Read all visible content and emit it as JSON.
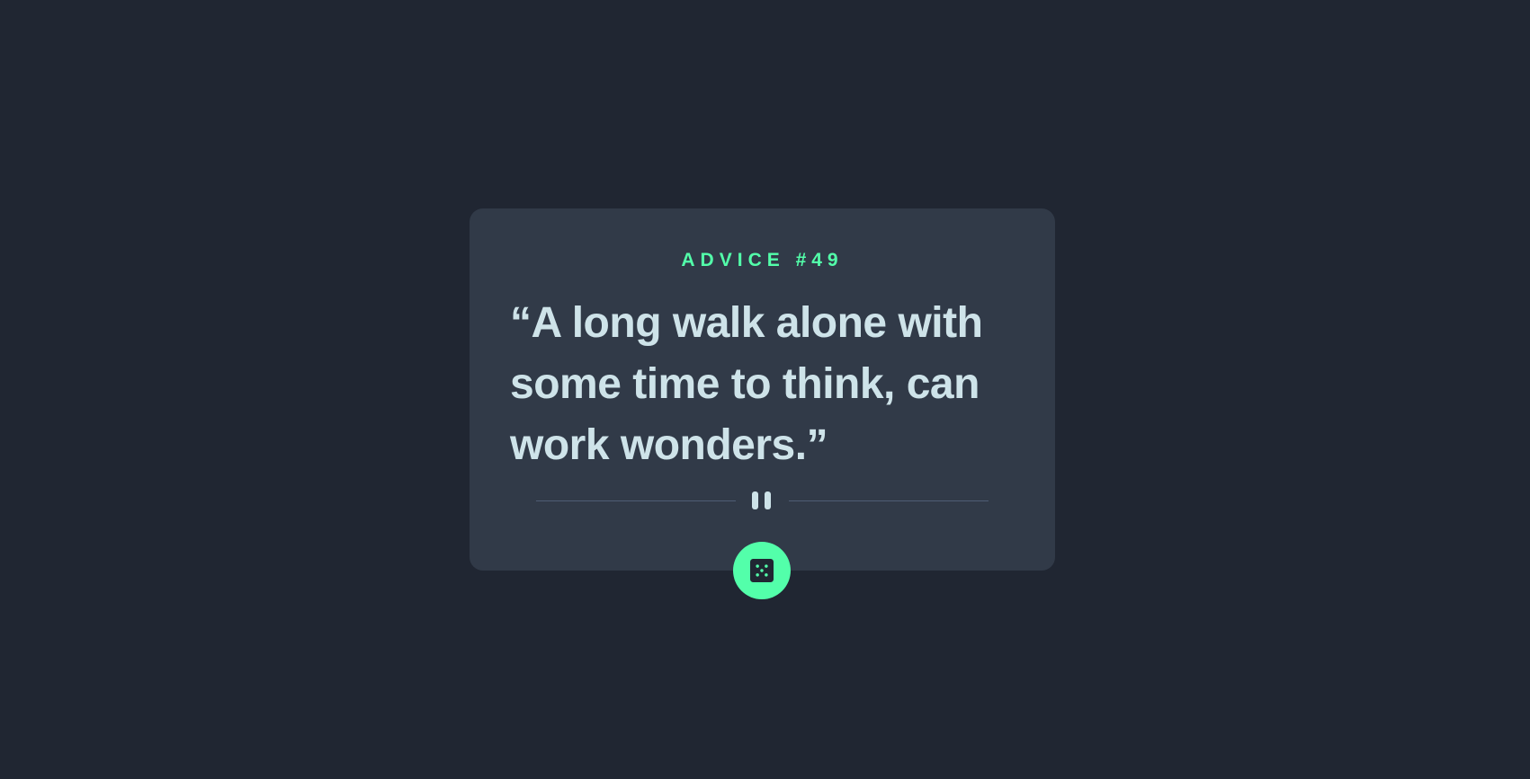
{
  "advice": {
    "id_label": "ADVICE #49",
    "text": "“A long walk alone with some time to think, can work wonders.”"
  },
  "divider": {
    "icon": "pause-icon"
  },
  "button": {
    "icon": "dice-icon",
    "aria_label": "Get new advice"
  },
  "colors": {
    "background": "#202632",
    "card": "#313a48",
    "accent": "#53ffaa",
    "text": "#cee3e9",
    "divider": "#4f5d74"
  }
}
